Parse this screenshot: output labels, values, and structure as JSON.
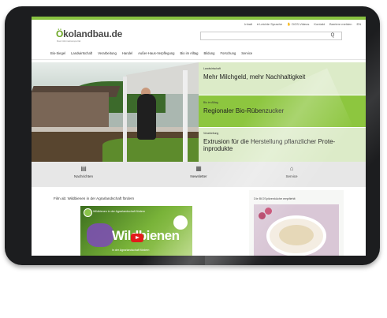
{
  "header": {
    "logo_o": "Ö",
    "logo_rest": "kolandbau.de",
    "logo_tagline": "Das Informationsportal",
    "utility": [
      "Inhalt",
      "Leichte Sprache",
      "DGS-Videos",
      "Kontakt",
      "Barriere melden",
      "EN"
    ],
    "search_button": "Q"
  },
  "nav": {
    "items": [
      "Bio-Siegel",
      "Landwirtschaft",
      "Verarbeitung",
      "Handel",
      "Außer-Haus-Verpflegung",
      "Bio im Alltag",
      "Bildung",
      "Forschung",
      "Service"
    ]
  },
  "hero": {
    "teasers": [
      {
        "kicker": "Landwirtschaft",
        "headline": "Mehr Milchgeld, mehr Nachhaltigkeit",
        "bg": "#dcebc8"
      },
      {
        "kicker": "Bio im Alltag",
        "headline": "Regionaler Bio-Rübenzucker",
        "bg": "#8dc63f"
      },
      {
        "kicker": "Verarbeitung",
        "headline": "Extrusion für die Herstellung pflanzlicher Prote-inprodukte",
        "bg": "#dcebc8"
      }
    ]
  },
  "quicklinks": [
    {
      "icon": "newspaper-icon",
      "label": "Nachrichten"
    },
    {
      "icon": "calendar-icon",
      "label": "Newsletter"
    },
    {
      "icon": "home-icon",
      "label": "Service"
    }
  ],
  "film": {
    "title": "Film ab: Wildbienen in der Agrarlandschaft fördern",
    "channel": "Wildbienen in der Agrarlandschaft fördern",
    "big_text": "Wildbienen",
    "sub_text": "in der Agrarlandschaft fördern"
  },
  "sidebar": {
    "title": "Die BIOSpitzenküche empfiehlt"
  },
  "colors": {
    "accent": "#88c240",
    "bezel": "#1c1d1f"
  }
}
